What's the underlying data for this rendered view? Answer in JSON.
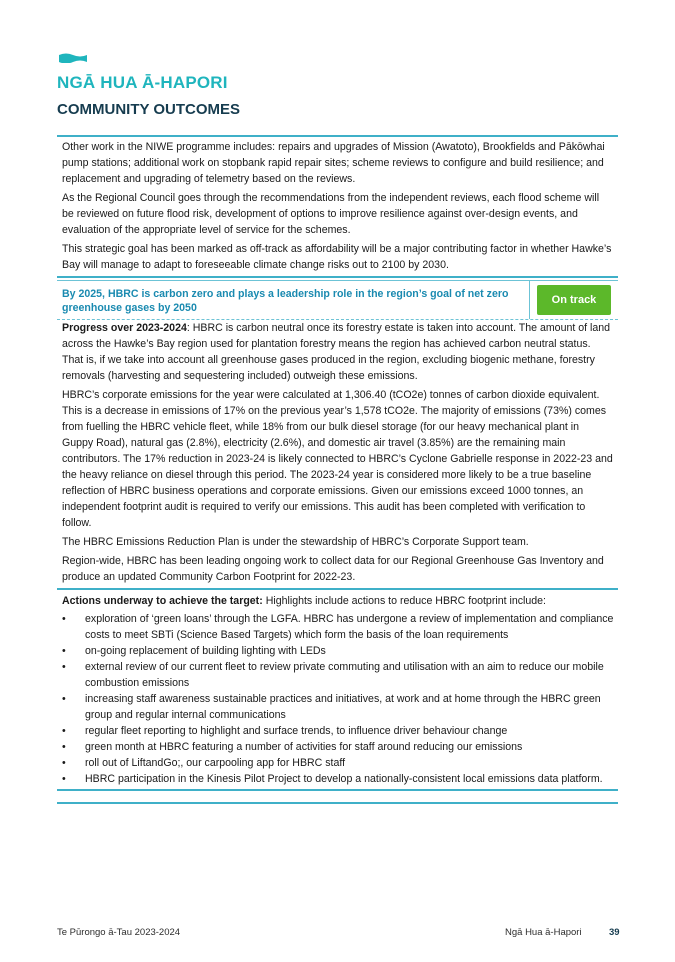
{
  "header": {
    "icon": "teal-flag-icon",
    "title_maori": "NGĀ HUA Ā-HAPORI",
    "title_english": "COMMUNITY OUTCOMES"
  },
  "intro_paragraphs": [
    "Other work in the NIWE programme includes: repairs and upgrades of Mission (Awatoto), Brookfields and Pākōwhai pump stations; additional work on stopbank rapid repair sites; scheme reviews to configure and build resilience; and replacement and upgrading of telemetry based on the reviews.",
    "As the Regional Council goes through the recommendations from the independent reviews, each flood scheme will be reviewed on future flood risk, development of options to improve resilience against over-design events, and evaluation of the appropriate level of service for the schemes.",
    "This strategic goal has been marked as off-track as affordability will be a major contributing factor in whether Hawke’s Bay will manage to adapt to foreseeable climate change risks out to 2100 by 2030."
  ],
  "goal": {
    "text": "By 2025, HBRC is carbon zero and plays a leadership role in the region’s goal of net zero greenhouse gases by 2050",
    "status": "On track",
    "status_color": "#5cb82a"
  },
  "progress": {
    "label": "Progress over 2023-2024",
    "paragraphs": [
      ": HBRC is carbon neutral once its forestry estate is taken into account. The amount of land across the Hawke’s Bay region used for plantation forestry means the region has achieved carbon neutral status. That is, if we take into account all greenhouse gases produced in the region, excluding biogenic methane, forestry removals (harvesting and sequestering included) outweigh these emissions.",
      "HBRC’s corporate emissions for the year were calculated at 1,306.40 (tCO2e) tonnes of carbon dioxide equivalent. This is a decrease in emissions of 17% on the previous year’s 1,578 tCO2e. The majority of emissions (73%) comes from fuelling the HBRC vehicle fleet, while 18% from our bulk diesel storage (for our heavy mechanical plant in Guppy Road), natural gas (2.8%), electricity (2.6%), and domestic air travel (3.85%) are the remaining main contributors. The 17% reduction in 2023-24 is likely connected to HBRC’s Cyclone Gabrielle response in 2022-23 and the heavy reliance on diesel through this period. The 2023-24 year is considered more likely to be a true baseline reflection of HBRC business operations and corporate emissions. Given our emissions exceed 1000 tonnes, an independent footprint audit is required to verify our emissions. This audit has been completed with verification to follow.",
      "The HBRC Emissions Reduction Plan is under the stewardship of HBRC’s Corporate Support team.",
      "Region-wide, HBRC has been leading ongoing work to collect data for our Regional Greenhouse Gas Inventory and produce an updated Community Carbon Footprint for 2022-23."
    ]
  },
  "actions": {
    "label": "Actions underway to achieve the target:",
    "intro": " Highlights include actions to reduce HBRC footprint include:",
    "items": [
      "exploration of ‘green loans’ through the LGFA. HBRC has undergone a review of implementation and compliance costs to meet SBTi (Science Based Targets) which form the basis of the loan requirements",
      "on-going replacement of building lighting with LEDs",
      "external review of our current fleet to review private commuting and utilisation with an aim to reduce our mobile combustion emissions",
      "increasing staff awareness sustainable practices and initiatives, at work and at home through the HBRC green group and regular internal communications",
      "regular fleet reporting to highlight and surface trends, to influence driver behaviour change",
      "green month at HBRC featuring a number of activities for staff around reducing our emissions",
      "roll out of LiftandGo;, our carpooling app for HBRC staff",
      "HBRC participation in the Kinesis Pilot Project to develop a nationally-consistent local emissions data platform."
    ]
  },
  "footer": {
    "report_title": "Te Pūrongo ā-Tau 2023-2024",
    "section": "Ngā Hua ā-Hapori",
    "page_number": "39"
  },
  "colors": {
    "teal_heading": "#1fb5bd",
    "navy_heading": "#163c4f",
    "rule": "#3fb0c8",
    "goal_text": "#1a8ab0"
  }
}
